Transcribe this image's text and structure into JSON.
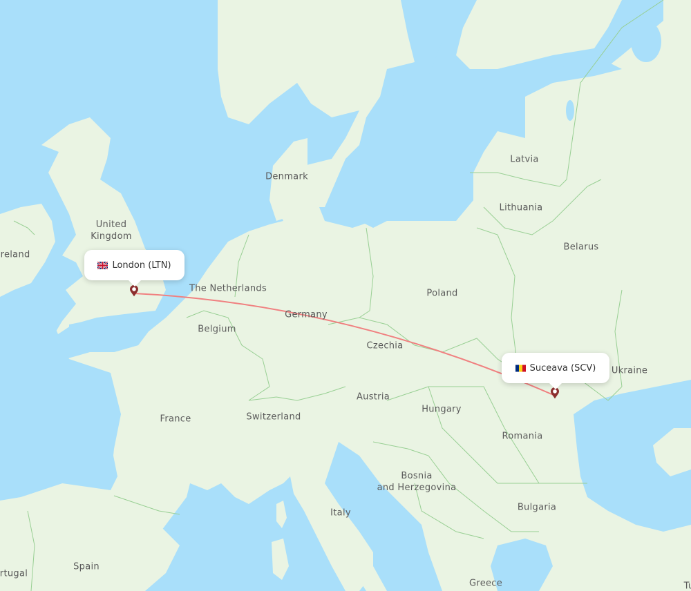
{
  "map": {
    "route_color": "#f08080",
    "marker_color": "#8b2e2e",
    "water_color": "#a9dffa",
    "land_color": "#eaf4e3",
    "border_color": "#98cf93"
  },
  "origin": {
    "city": "London",
    "code": "LTN",
    "label": "London (LTN)",
    "flag": "gb-flag-icon"
  },
  "destination": {
    "city": "Suceava",
    "code": "SCV",
    "label": "Suceava (SCV)",
    "flag": "ro-flag-icon"
  },
  "countries": [
    {
      "name": "Ireland"
    },
    {
      "name": "United\nKingdom"
    },
    {
      "name": "Denmark"
    },
    {
      "name": "The Netherlands"
    },
    {
      "name": "Belgium"
    },
    {
      "name": "Germany"
    },
    {
      "name": "France"
    },
    {
      "name": "Switzerland"
    },
    {
      "name": "Czechia"
    },
    {
      "name": "Austria"
    },
    {
      "name": "Poland"
    },
    {
      "name": "Latvia"
    },
    {
      "name": "Lithuania"
    },
    {
      "name": "Belarus"
    },
    {
      "name": "Ukraine"
    },
    {
      "name": "Hungary"
    },
    {
      "name": "Romania"
    },
    {
      "name": "Bosnia\nand Herzegovina"
    },
    {
      "name": "Italy"
    },
    {
      "name": "Bulgaria"
    },
    {
      "name": "Spain"
    },
    {
      "name": "Portugal"
    },
    {
      "name": "Greece"
    },
    {
      "name": "Tu"
    }
  ]
}
